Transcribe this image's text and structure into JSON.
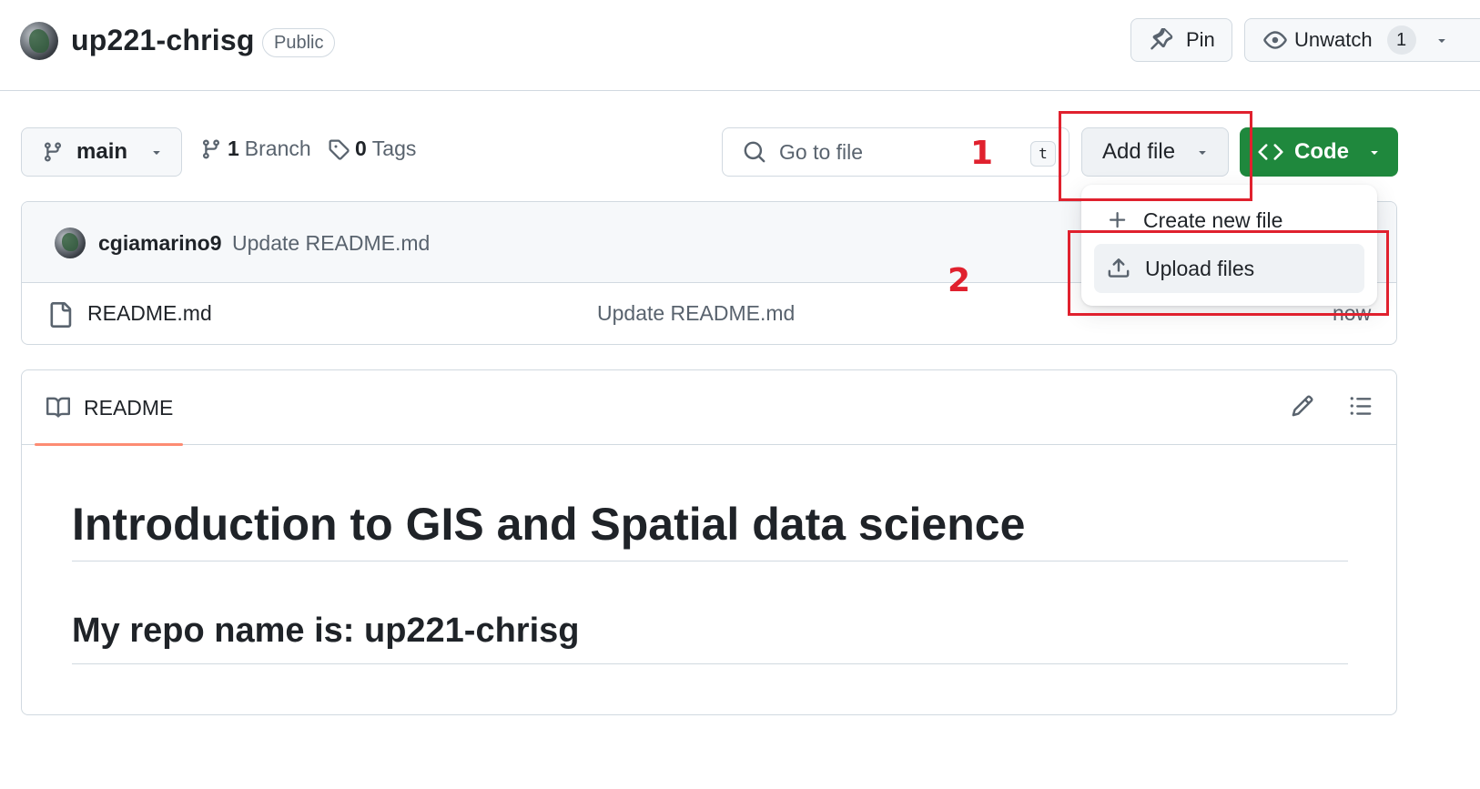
{
  "header": {
    "repo_name": "up221-chrisg",
    "visibility": "Public",
    "pin_label": "Pin",
    "unwatch_label": "Unwatch",
    "watch_count": "1"
  },
  "toolbar": {
    "branch": "main",
    "branch_count": "1",
    "branch_label": "Branch",
    "tag_count": "0",
    "tag_label": "Tags",
    "search_placeholder": "Go to file",
    "search_shortcut": "t",
    "add_file_label": "Add file",
    "code_label": "Code"
  },
  "dropdown": {
    "items": [
      {
        "label": "Create new file",
        "icon": "plus-icon"
      },
      {
        "label": "Upload files",
        "icon": "upload-icon"
      }
    ]
  },
  "commit": {
    "author": "cgiamarino9",
    "message": "Update README.md"
  },
  "files": [
    {
      "name": "README.md",
      "commit_message": "Update README.md",
      "time": "now",
      "icon": "file-icon"
    }
  ],
  "annotations": {
    "step1": "1",
    "step2": "2"
  },
  "readme": {
    "tab_label": "README",
    "h1": "Introduction to GIS and Spatial data science",
    "h2": "My repo name is: up221-chrisg"
  },
  "colors": {
    "accent_green": "#1f883d",
    "annotation_red": "#e0212e",
    "tab_underline": "#fd8c73"
  }
}
